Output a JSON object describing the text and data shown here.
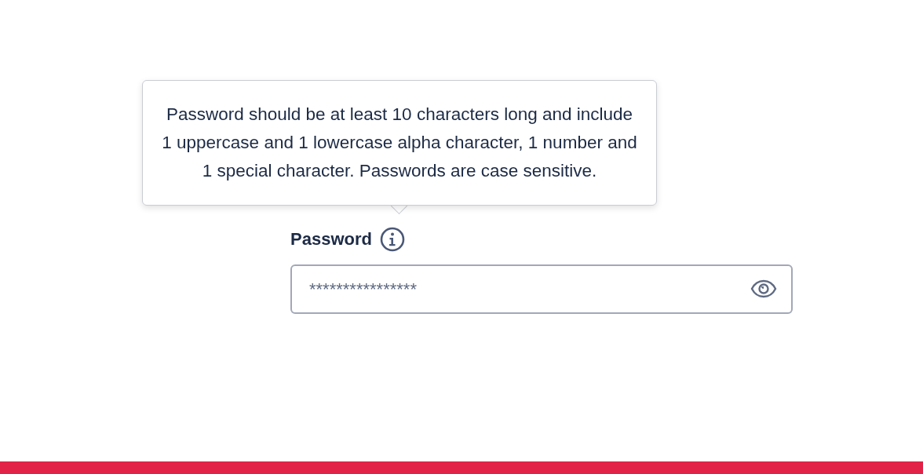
{
  "tooltip": {
    "text": "Password should be at least 10 characters long and include 1 uppercase and 1 lowercase alpha character, 1 number and 1 special character. Passwords are case sensitive."
  },
  "password_field": {
    "label": "Password",
    "placeholder": "****************"
  }
}
